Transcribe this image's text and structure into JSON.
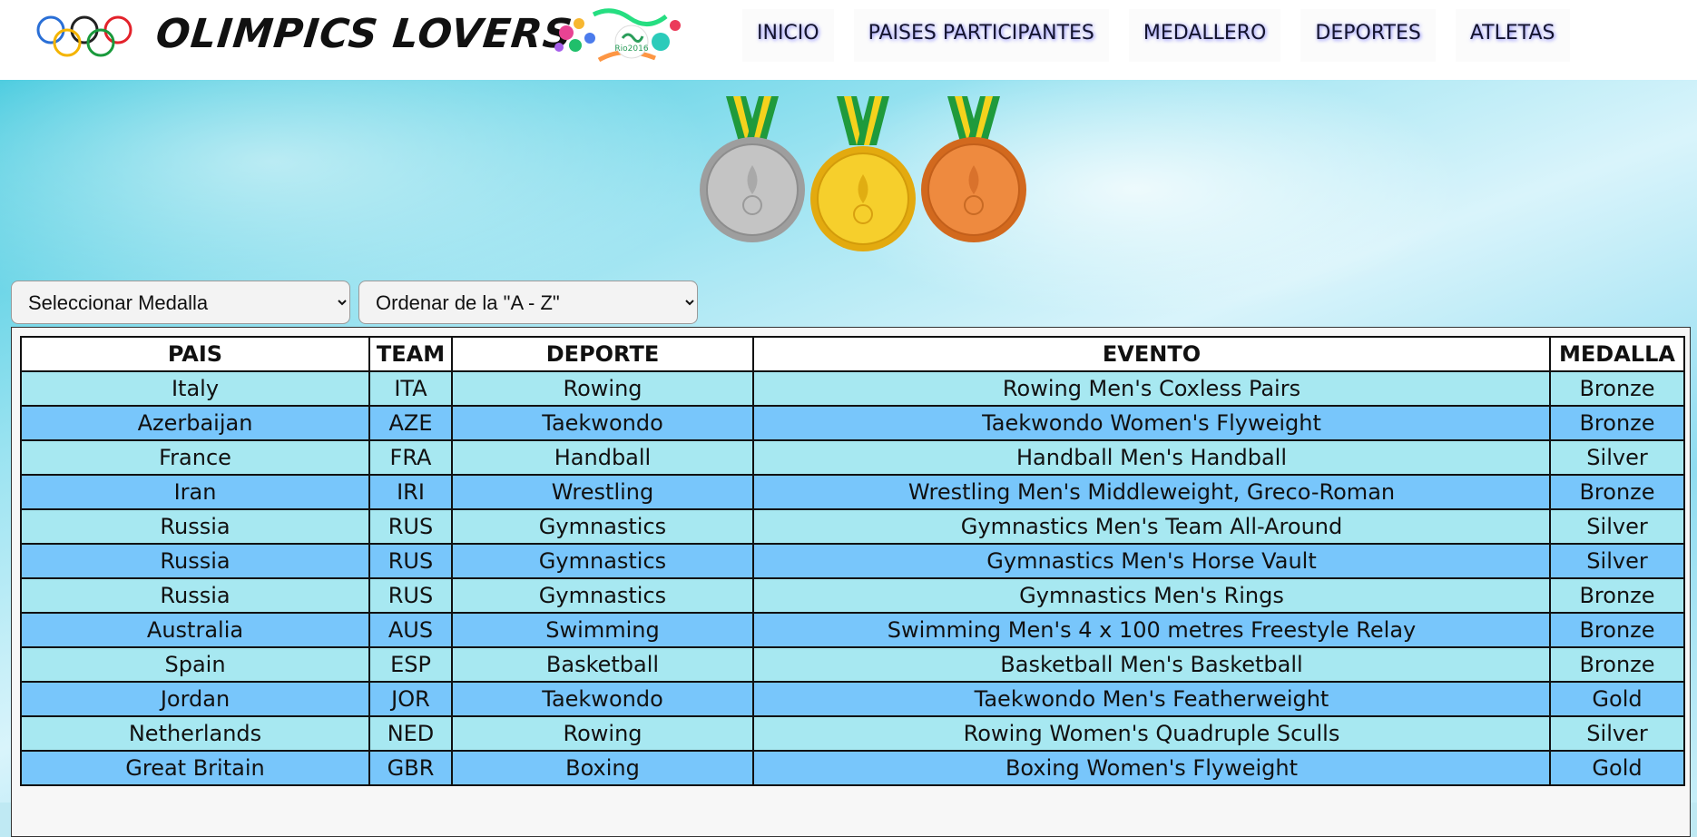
{
  "header": {
    "brand": "OLIMPICS LOVERS",
    "rio_logo_text": "Rio2016",
    "nav": [
      "INICIO",
      "PAISES PARTICIPANTES",
      "MEDALLERO",
      "DEPORTES",
      "ATLETAS"
    ]
  },
  "filters": {
    "medal_select": {
      "selected": "Seleccionar Medalla"
    },
    "order_select": {
      "selected": "Ordenar de la \"A - Z\""
    }
  },
  "colors": {
    "row_odd": "#a7e8f1",
    "row_even": "#78c6fb",
    "silver": "#b9b9b9",
    "gold": "#f2c21a",
    "bronze": "#e87d34",
    "ribbon_green": "#1f9a3c",
    "ribbon_yellow": "#f5d21d"
  },
  "table": {
    "headers": [
      "PAIS",
      "TEAM",
      "DEPORTE",
      "EVENTO",
      "MEDALLA"
    ],
    "rows": [
      [
        "Italy",
        "ITA",
        "Rowing",
        "Rowing Men's Coxless Pairs",
        "Bronze"
      ],
      [
        "Azerbaijan",
        "AZE",
        "Taekwondo",
        "Taekwondo Women's Flyweight",
        "Bronze"
      ],
      [
        "France",
        "FRA",
        "Handball",
        "Handball Men's Handball",
        "Silver"
      ],
      [
        "Iran",
        "IRI",
        "Wrestling",
        "Wrestling Men's Middleweight, Greco-Roman",
        "Bronze"
      ],
      [
        "Russia",
        "RUS",
        "Gymnastics",
        "Gymnastics Men's Team All-Around",
        "Silver"
      ],
      [
        "Russia",
        "RUS",
        "Gymnastics",
        "Gymnastics Men's Horse Vault",
        "Silver"
      ],
      [
        "Russia",
        "RUS",
        "Gymnastics",
        "Gymnastics Men's Rings",
        "Bronze"
      ],
      [
        "Australia",
        "AUS",
        "Swimming",
        "Swimming Men's 4 x 100 metres Freestyle Relay",
        "Bronze"
      ],
      [
        "Spain",
        "ESP",
        "Basketball",
        "Basketball Men's Basketball",
        "Bronze"
      ],
      [
        "Jordan",
        "JOR",
        "Taekwondo",
        "Taekwondo Men's Featherweight",
        "Gold"
      ],
      [
        "Netherlands",
        "NED",
        "Rowing",
        "Rowing Women's Quadruple Sculls",
        "Silver"
      ],
      [
        "Great Britain",
        "GBR",
        "Boxing",
        "Boxing Women's Flyweight",
        "Gold"
      ]
    ]
  }
}
